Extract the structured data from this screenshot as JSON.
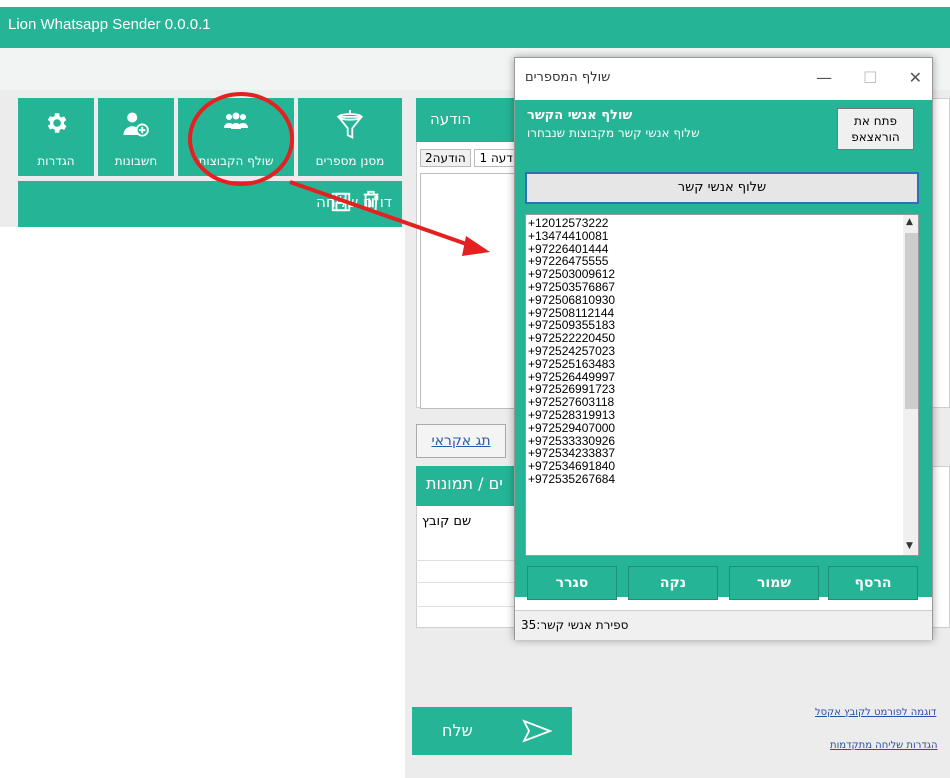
{
  "app": {
    "title": "Lion Whatsapp Sender 0.0.0.1"
  },
  "nav": [
    {
      "label": "הגדרות",
      "icon": "gear-icon"
    },
    {
      "label": "חשבונות",
      "icon": "add-user-icon"
    },
    {
      "label": "שולף הקבוצות",
      "icon": "group-icon"
    },
    {
      "label": "מסנן מספרים",
      "icon": "filter-icon"
    }
  ],
  "report": {
    "label": "דו\"ח שליחה"
  },
  "message": {
    "header": "הודעה",
    "tabs": [
      "הודעה 1",
      "הודעה2"
    ]
  },
  "random_tag": "תג אקראי",
  "files": {
    "header": "ים / תמונות",
    "column": "שם קובץ"
  },
  "send": {
    "label": "שלח"
  },
  "links": {
    "excel_sample": "דוגמה לפורמט לקובץ אקסל",
    "advanced_settings": "הגדרות שליחה מתקדמות"
  },
  "dialog": {
    "title": "שולף המספרים",
    "header_title": "שולף אנשי הקשר",
    "header_subtitle": "שלוף אנשי קשר מקבוצות שנבחרו",
    "open_whatsapp": "פתח את הוראצאפ",
    "fetch_button": "שלוף אנשי קשר",
    "numbers": [
      "+12012573222",
      "+13474410081",
      "+97226401444",
      "+97226475555",
      "+972503009612",
      "+972503576867",
      "+972506810930",
      "+972508112144",
      "+972509355183",
      "+972522220450",
      "+972524257023",
      "+972525163483",
      "+972526449997",
      "+972526991723",
      "+972527603118",
      "+972528319913",
      "+972529407000",
      "+972533330926",
      "+972534233837",
      "+972534691840",
      "+972535267684"
    ],
    "buttons": {
      "add": "הרסף",
      "save": "שמור",
      "clear": "נקה",
      "close": "סגרר"
    },
    "footer": "ספירת אנשי קשר:35"
  }
}
